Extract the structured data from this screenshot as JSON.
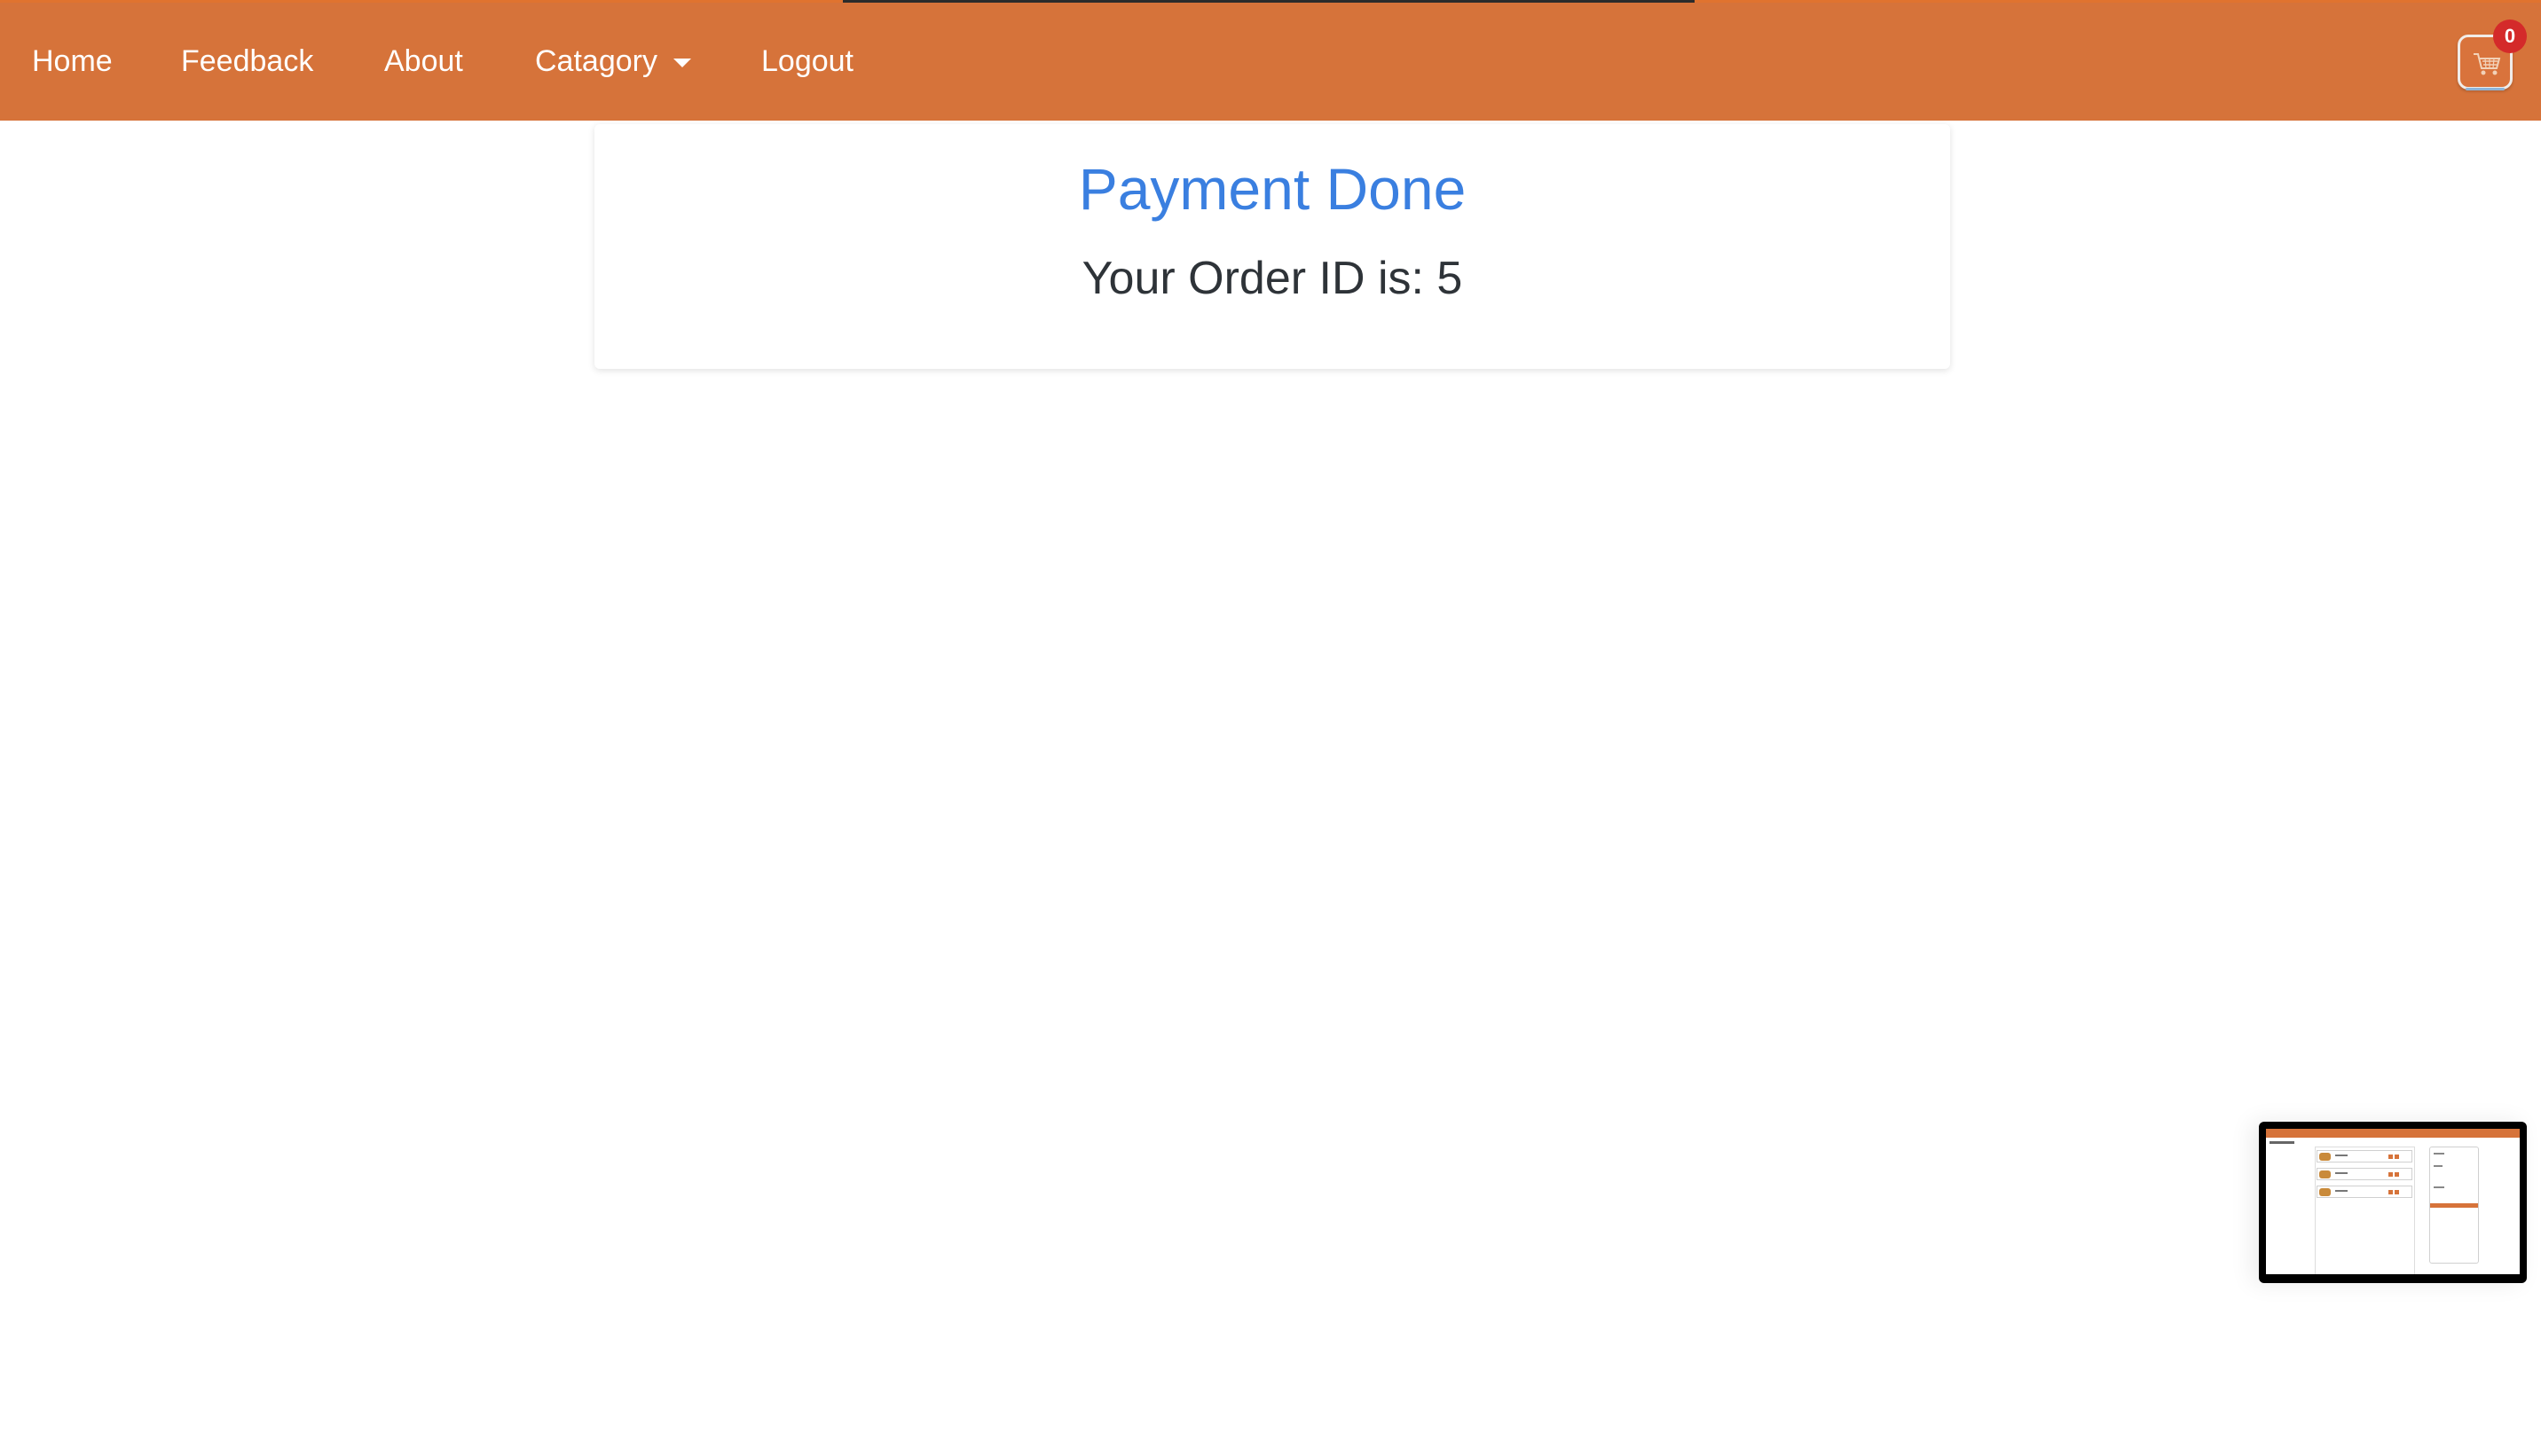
{
  "nav": {
    "items": [
      {
        "label": "Home"
      },
      {
        "label": "Feedback"
      },
      {
        "label": "About"
      },
      {
        "label": "Catagory"
      },
      {
        "label": "Logout"
      }
    ]
  },
  "cart": {
    "icon": "shopping-cart-icon",
    "count": "0"
  },
  "confirmation": {
    "title": "Payment Done",
    "order_line": "Your Order ID is: 5"
  },
  "colors": {
    "navbar": "#d6733a",
    "title": "#3a7fe0",
    "badge": "#d42a2a",
    "text": "#2e3338"
  }
}
